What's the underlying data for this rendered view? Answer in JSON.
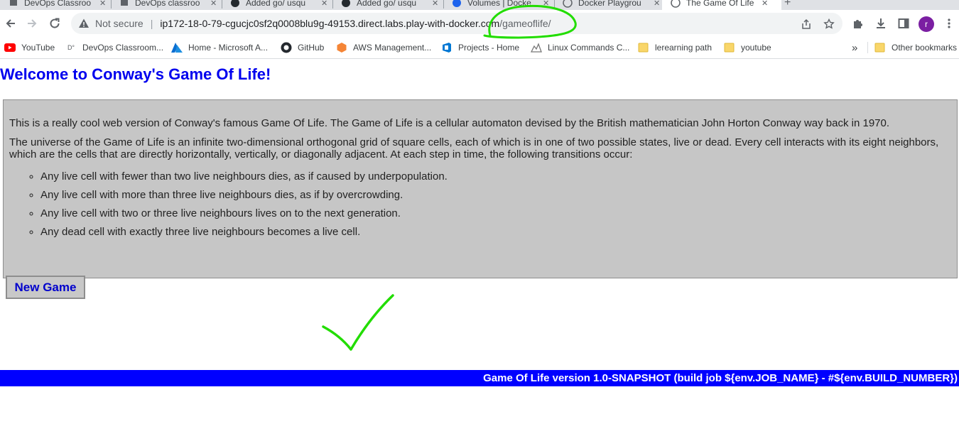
{
  "browser": {
    "tabs": [
      {
        "label": "DevOps Classroo",
        "icon": "devops-icon",
        "active": false
      },
      {
        "label": "DevOps classroo",
        "icon": "devops-icon",
        "active": false
      },
      {
        "label": "Added go/ usqu",
        "icon": "github-icon",
        "active": false
      },
      {
        "label": "Added go/ usqu",
        "icon": "github-icon",
        "active": false
      },
      {
        "label": "Volumes | Docke",
        "icon": "docker-icon",
        "active": false
      },
      {
        "label": "Docker Playgrou",
        "icon": "globe-icon",
        "active": false
      },
      {
        "label": "The Game Of Life",
        "icon": "globe-icon",
        "active": true
      }
    ],
    "address_bar": {
      "security_label": "Not secure",
      "url_host": "ip172-18-0-79-cgucjc0sf2q0008blu9g-49153.direct.labs.play-with-docker.com",
      "url_path": "/gameoflife/"
    },
    "profile_initial": "r",
    "bookmarks": [
      {
        "label": "YouTube",
        "icon": "youtube-icon"
      },
      {
        "label": "DevOps Classroom...",
        "icon": "devops-icon"
      },
      {
        "label": "Home - Microsoft A...",
        "icon": "azure-icon"
      },
      {
        "label": "GitHub",
        "icon": "github-icon"
      },
      {
        "label": "AWS Management...",
        "icon": "aws-icon"
      },
      {
        "label": "Projects - Home",
        "icon": "azure-devops-icon"
      },
      {
        "label": "Linux Commands C...",
        "icon": "linux-icon"
      },
      {
        "label": "lerearning path",
        "icon": "folder-icon"
      },
      {
        "label": "youtube",
        "icon": "folder-icon"
      }
    ],
    "other_bookmarks": "Other bookmarks",
    "overflow_label": "»"
  },
  "page": {
    "title": "Welcome to Conway's Game Of Life!",
    "intro_p1": "This is a really cool web version of Conway's famous Game Of Life. The Game of Life is a cellular automaton devised by the British mathematician John Horton Conway way back in 1970.",
    "intro_p2": "The universe of the Game of Life is an infinite two-dimensional orthogonal grid of square cells, each of which is in one of two possible states, live or dead. Every cell interacts with its eight neighbors, which are the cells that are directly horizontally, vertically, or diagonally adjacent. At each step in time, the following transitions occur:",
    "rules": [
      "Any live cell with fewer than two live neighbours dies, as if caused by underpopulation.",
      "Any live cell with more than three live neighbours dies, as if by overcrowding.",
      "Any live cell with two or three live neighbours lives on to the next generation.",
      "Any dead cell with exactly three live neighbours becomes a live cell."
    ],
    "new_game_label": "New Game",
    "footer": "Game Of Life version 1.0-SNAPSHOT (build job ${env.JOB_NAME} - #${env.BUILD_NUMBER})"
  },
  "annotations": {
    "color": "#22dd00",
    "marks": [
      "circle-around-url-path",
      "checkmark"
    ]
  }
}
